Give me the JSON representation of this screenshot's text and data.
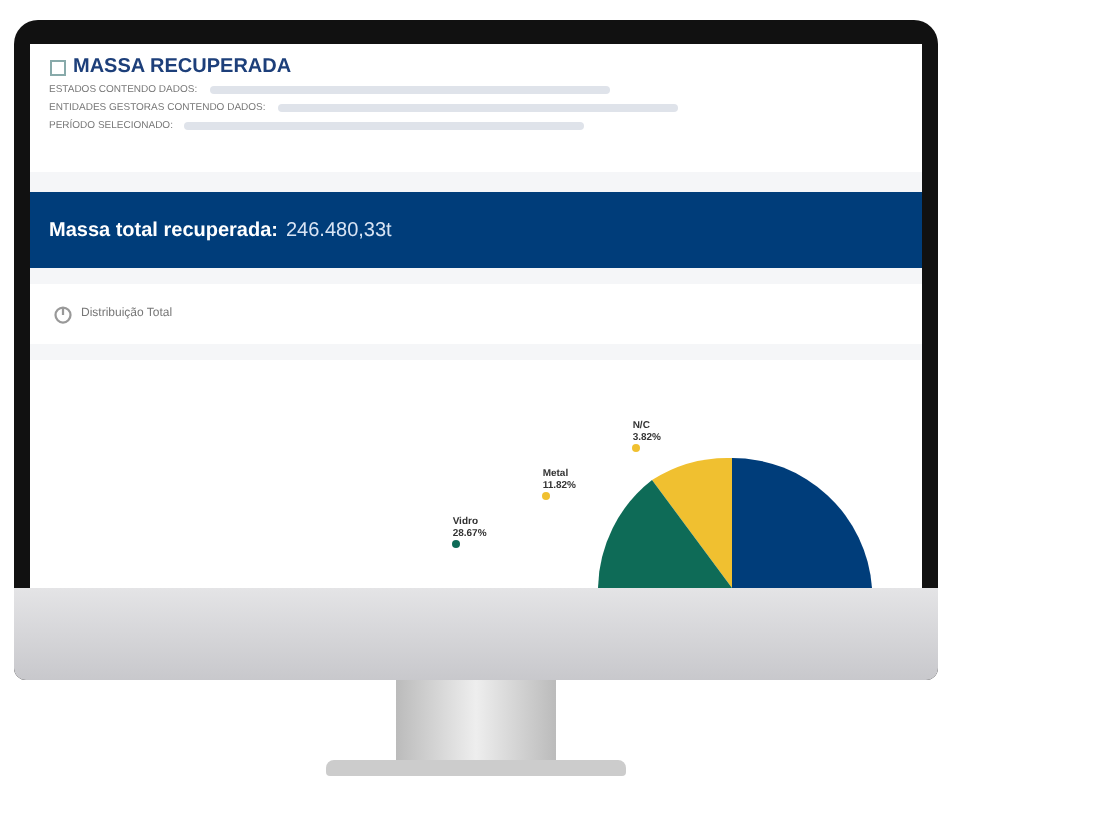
{
  "header": {
    "title": "MASSA RECUPERADA",
    "filters": [
      {
        "label": "ESTADOS CONTENDO DADOS:"
      },
      {
        "label": "ENTIDADES GESTORAS CONTENDO DADOS:"
      },
      {
        "label": "PERÍODO SELECIONADO:"
      }
    ]
  },
  "total_band": {
    "label": "Massa total recuperada:",
    "value": "246.480,33t"
  },
  "section": {
    "title": "Distribuição Total"
  },
  "pie_labels": [
    {
      "name": "N/C",
      "value": "3.82%",
      "color": "#f0c030"
    },
    {
      "name": "Metal",
      "value": "11.82%",
      "color": "#f0c030"
    },
    {
      "name": "Vidro",
      "value": "28.67%",
      "color": "#0e6b57"
    }
  ]
}
